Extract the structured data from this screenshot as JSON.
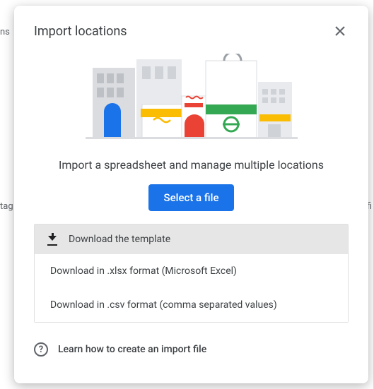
{
  "dialog": {
    "title": "Import locations",
    "subtitle": "Import a spreadsheet and manage multiple locations",
    "select_file_label": "Select a file",
    "template": {
      "header": "Download the template",
      "options": [
        "Download in .xlsx format (Microsoft Excel)",
        "Download in .csv format (comma separated values)"
      ]
    },
    "learn_link": "Learn how to create an import file"
  },
  "colors": {
    "primary": "#1a73e8"
  }
}
